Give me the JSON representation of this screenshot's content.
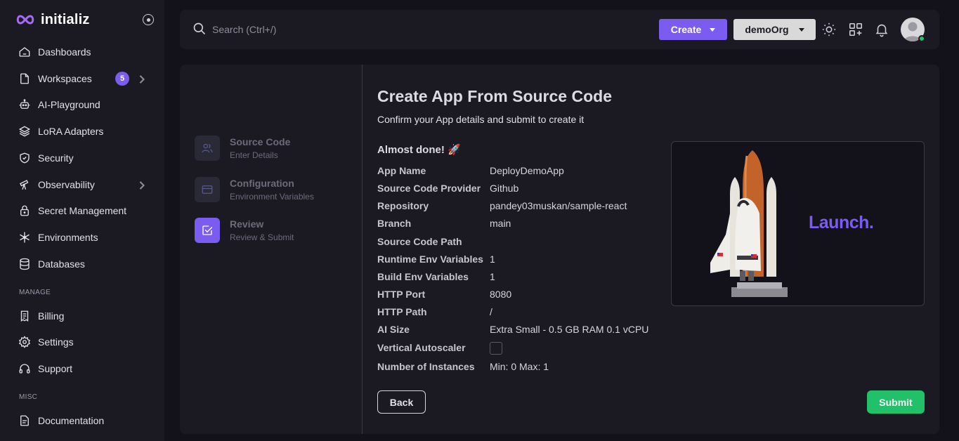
{
  "brand": {
    "name": "initializ"
  },
  "sidebar": {
    "items": [
      {
        "label": "Dashboards",
        "icon": "home-icon"
      },
      {
        "label": "Workspaces",
        "icon": "file-icon",
        "badge": "5"
      },
      {
        "label": "AI-Playground",
        "icon": "robot-icon"
      },
      {
        "label": "LoRA Adapters",
        "icon": "layers-icon"
      },
      {
        "label": "Security",
        "icon": "shield-icon"
      },
      {
        "label": "Observability",
        "icon": "telescope-icon"
      },
      {
        "label": "Secret Management",
        "icon": "lock-icon"
      },
      {
        "label": "Environments",
        "icon": "snowflake-icon"
      },
      {
        "label": "Databases",
        "icon": "database-icon"
      }
    ],
    "manage_label": "MANAGE",
    "manage_items": [
      {
        "label": "Billing",
        "icon": "receipt-icon"
      },
      {
        "label": "Settings",
        "icon": "gear-icon"
      },
      {
        "label": "Support",
        "icon": "headphones-icon"
      }
    ],
    "misc_label": "MISC",
    "misc_items": [
      {
        "label": "Documentation",
        "icon": "document-icon"
      }
    ]
  },
  "header": {
    "search_placeholder": "Search (Ctrl+/)",
    "create_label": "Create",
    "org_label": "demoOrg"
  },
  "steps": [
    {
      "title": "Source Code",
      "subtitle": "Enter Details",
      "state": "done"
    },
    {
      "title": "Configuration",
      "subtitle": "Environment Variables",
      "state": "done"
    },
    {
      "title": "Review",
      "subtitle": "Review & Submit",
      "state": "active"
    }
  ],
  "main": {
    "title": "Create App From Source Code",
    "subtitle": "Confirm your App details and submit to create it",
    "almost_done": "Almost done! 🚀",
    "details": [
      {
        "label": "App Name",
        "value": "DeployDemoApp"
      },
      {
        "label": "Source Code Provider",
        "value": "Github"
      },
      {
        "label": "Repository",
        "value": "pandey03muskan/sample-react"
      },
      {
        "label": "Branch",
        "value": "main"
      },
      {
        "label": "Source Code Path",
        "value": ""
      },
      {
        "label": "Runtime Env Variables",
        "value": "1"
      },
      {
        "label": "Build Env Variables",
        "value": "1"
      },
      {
        "label": "HTTP Port",
        "value": "8080"
      },
      {
        "label": "HTTP Path",
        "value": "/"
      },
      {
        "label": "AI Size",
        "value": "Extra Small - 0.5 GB RAM 0.1 vCPU"
      },
      {
        "label": "Vertical Autoscaler",
        "value": "",
        "checked": false
      },
      {
        "label": "Number of Instances",
        "value": "Min: 0 Max: 1"
      }
    ],
    "launch_text": "Launch.",
    "back_label": "Back",
    "submit_label": "Submit"
  },
  "colors": {
    "accent": "#7b5cf0",
    "submit": "#22c068",
    "background": "#13121a",
    "panel": "#1b1a23"
  }
}
